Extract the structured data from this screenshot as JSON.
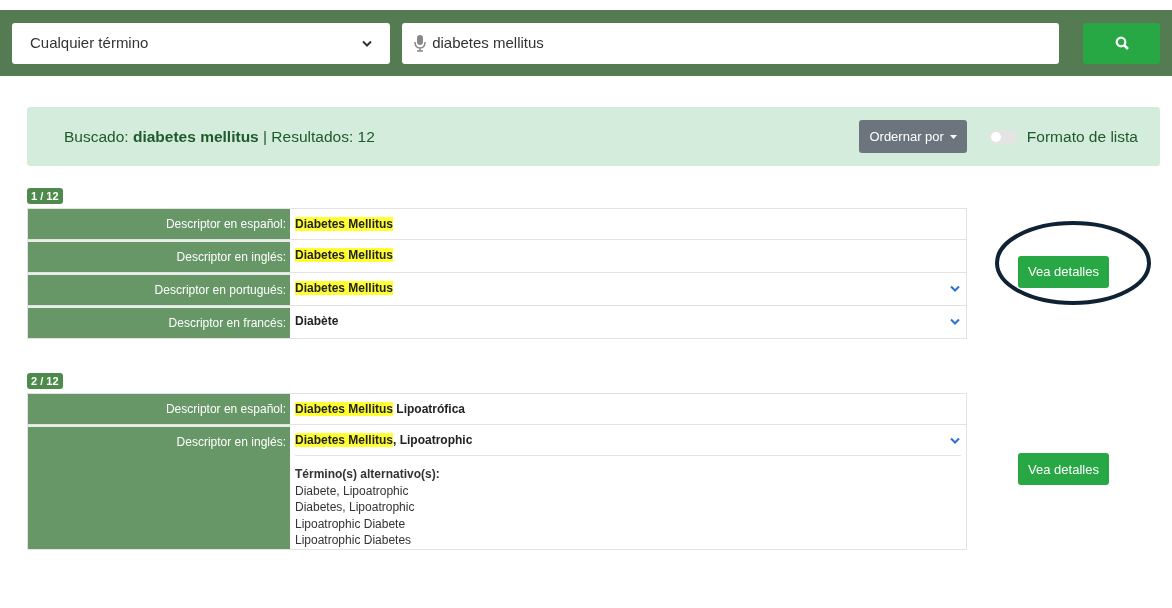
{
  "search_bar": {
    "scope": "Cualquier término",
    "query": "diabetes mellitus"
  },
  "summary": {
    "label": "Buscado:",
    "term": "diabetes mellitus",
    "results_label": "| Resultados: 12",
    "sort_button": "Ordernar por",
    "list_format": {
      "label": "Formato de lista",
      "on": false
    }
  },
  "results": [
    {
      "badge": "1 / 12",
      "button": "Vea detalles",
      "circled": true,
      "rows": [
        {
          "label": "Descriptor en español:",
          "expandable": false,
          "value": [
            {
              "text": "Diabetes Mellitus",
              "highlighted": true
            }
          ]
        },
        {
          "label": "Descriptor en inglés:",
          "expandable": false,
          "value": [
            {
              "text": "Diabetes Mellitus",
              "highlighted": true
            }
          ]
        },
        {
          "label": "Descriptor en portugués:",
          "expandable": true,
          "value": [
            {
              "text": "Diabetes Mellitus",
              "highlighted": true
            }
          ]
        },
        {
          "label": "Descriptor en francés:",
          "expandable": true,
          "value": [
            {
              "text": "Diabète",
              "highlighted": false
            }
          ]
        }
      ]
    },
    {
      "badge": "2 / 12",
      "button": "Vea detalles",
      "circled": false,
      "rows": [
        {
          "label": "Descriptor en español:",
          "expandable": false,
          "value": [
            {
              "text": "Diabetes Mellitus",
              "highlighted": true
            },
            {
              "text": " Lipoatrófica",
              "highlighted": false
            }
          ]
        },
        {
          "label": "Descriptor en inglés:",
          "expandable": true,
          "value": [
            {
              "text": "Diabetes Mellitus",
              "highlighted": true
            },
            {
              "text": ", Lipoatrophic",
              "highlighted": false
            }
          ],
          "alternatives": {
            "heading": "Término(s) alternativo(s):",
            "terms": [
              "Diabete, Lipoatrophic",
              "Diabetes, Lipoatrophic",
              "Lipoatrophic Diabete",
              "Lipoatrophic Diabetes"
            ]
          }
        }
      ]
    }
  ]
}
